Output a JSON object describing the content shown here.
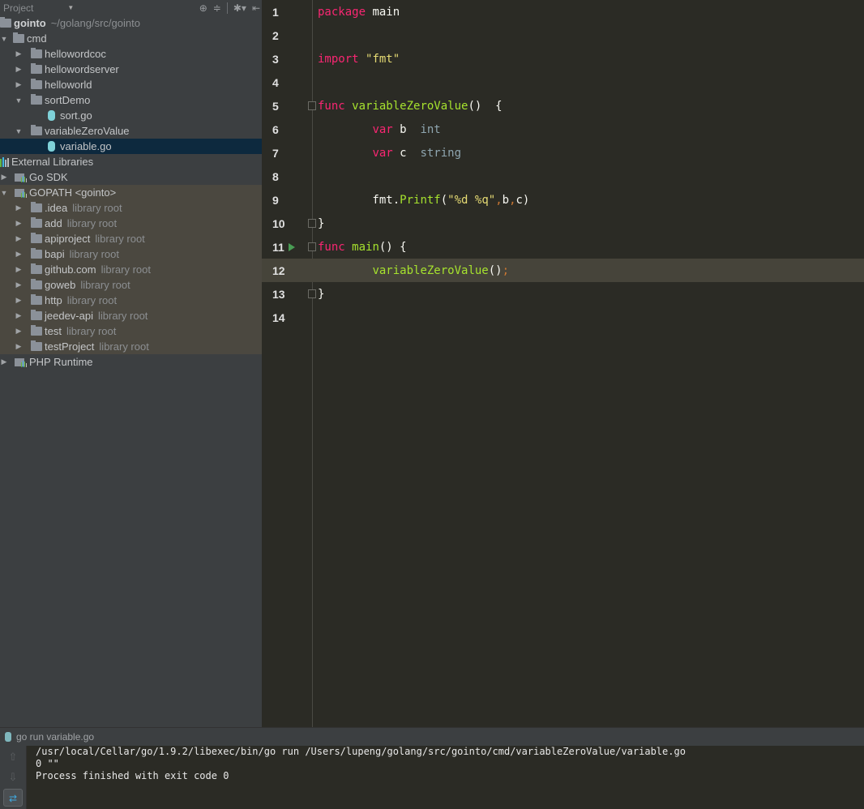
{
  "sidebar": {
    "title": "Project",
    "tools": [
      "locate-icon",
      "collapse-icon",
      "settings-icon",
      "hide-icon"
    ],
    "project": {
      "name": "gointo",
      "path": "~/golang/src/gointo"
    },
    "tree": [
      {
        "label": "cmd",
        "hint": "",
        "depth": 1,
        "state": "open",
        "icon": "folder"
      },
      {
        "label": "hellowordcoc",
        "hint": "",
        "depth": 2,
        "state": "closed",
        "icon": "folder"
      },
      {
        "label": "hellowordserver",
        "hint": "",
        "depth": 2,
        "state": "closed",
        "icon": "folder"
      },
      {
        "label": "helloworld",
        "hint": "",
        "depth": 2,
        "state": "closed",
        "icon": "folder"
      },
      {
        "label": "sortDemo",
        "hint": "",
        "depth": 2,
        "state": "open",
        "icon": "folder"
      },
      {
        "label": "sort.go",
        "hint": "",
        "depth": 3,
        "state": "leaf",
        "icon": "gofile"
      },
      {
        "label": "variableZeroValue",
        "hint": "",
        "depth": 2,
        "state": "open",
        "icon": "folder"
      },
      {
        "label": "variable.go",
        "hint": "",
        "depth": 3,
        "state": "leaf",
        "icon": "gofile",
        "selected": true
      }
    ],
    "external_libraries": "External Libraries",
    "ext_tree": [
      {
        "label": "Go SDK",
        "depth": 1,
        "state": "closed",
        "icon": "libfolder"
      },
      {
        "label": "GOPATH <gointo>",
        "depth": 1,
        "state": "open",
        "icon": "libfolder"
      }
    ],
    "gopath_items": [
      {
        "label": ".idea",
        "hint": "library root"
      },
      {
        "label": "add",
        "hint": "library root"
      },
      {
        "label": "apiproject",
        "hint": "library root"
      },
      {
        "label": "bapi",
        "hint": "library root"
      },
      {
        "label": "github.com",
        "hint": "library root"
      },
      {
        "label": "goweb",
        "hint": "library root"
      },
      {
        "label": "http",
        "hint": "library root"
      },
      {
        "label": "jeedev-api",
        "hint": "library root"
      },
      {
        "label": "test",
        "hint": "library root"
      },
      {
        "label": "testProject",
        "hint": "library root"
      }
    ],
    "php_runtime": "PHP Runtime"
  },
  "editor": {
    "current_line": 12,
    "lines": [
      {
        "n": "1",
        "tokens": [
          [
            "kw",
            "package"
          ],
          [
            "pl",
            " main"
          ]
        ]
      },
      {
        "n": "2",
        "tokens": []
      },
      {
        "n": "3",
        "tokens": [
          [
            "kw",
            "import"
          ],
          [
            "pl",
            " "
          ],
          [
            "str",
            "\"fmt\""
          ]
        ]
      },
      {
        "n": "4",
        "tokens": []
      },
      {
        "n": "5",
        "fold": true,
        "tokens": [
          [
            "kw",
            "func"
          ],
          [
            "pl",
            " "
          ],
          [
            "fn",
            "variableZeroValue"
          ],
          [
            "pl",
            "()  {"
          ]
        ]
      },
      {
        "n": "6",
        "tokens": [
          [
            "pl",
            "        "
          ],
          [
            "kw",
            "var"
          ],
          [
            "pl",
            " b  "
          ],
          [
            "typ",
            "int"
          ]
        ]
      },
      {
        "n": "7",
        "tokens": [
          [
            "pl",
            "        "
          ],
          [
            "kw",
            "var"
          ],
          [
            "pl",
            " c  "
          ],
          [
            "typ",
            "string"
          ]
        ]
      },
      {
        "n": "8",
        "tokens": []
      },
      {
        "n": "9",
        "tokens": [
          [
            "pl",
            "        fmt."
          ],
          [
            "fn",
            "Printf"
          ],
          [
            "pl",
            "("
          ],
          [
            "str",
            "\"%d %q\""
          ],
          [
            "semi",
            ","
          ],
          [
            "pl",
            "b"
          ],
          [
            "semi",
            ","
          ],
          [
            "pl",
            "c)"
          ]
        ]
      },
      {
        "n": "10",
        "fold": true,
        "tokens": [
          [
            "pl",
            "}"
          ]
        ]
      },
      {
        "n": "11",
        "fold": true,
        "run": true,
        "tokens": [
          [
            "kw",
            "func"
          ],
          [
            "pl",
            " "
          ],
          [
            "fn",
            "main"
          ],
          [
            "pl",
            "() {"
          ]
        ]
      },
      {
        "n": "12",
        "tokens": [
          [
            "pl",
            "        "
          ],
          [
            "fn",
            "variableZeroValue"
          ],
          [
            "pl",
            "()"
          ],
          [
            "semi",
            ";"
          ]
        ]
      },
      {
        "n": "13",
        "fold": true,
        "tokens": [
          [
            "pl",
            "}"
          ]
        ]
      },
      {
        "n": "14",
        "tokens": []
      }
    ]
  },
  "run": {
    "tab_label": "go run variable.go",
    "output": [
      "/usr/local/Cellar/go/1.9.2/libexec/bin/go run /Users/lupeng/golang/src/gointo/cmd/variableZeroValue/variable.go",
      "0 \"\"",
      "Process finished with exit code 0"
    ]
  }
}
